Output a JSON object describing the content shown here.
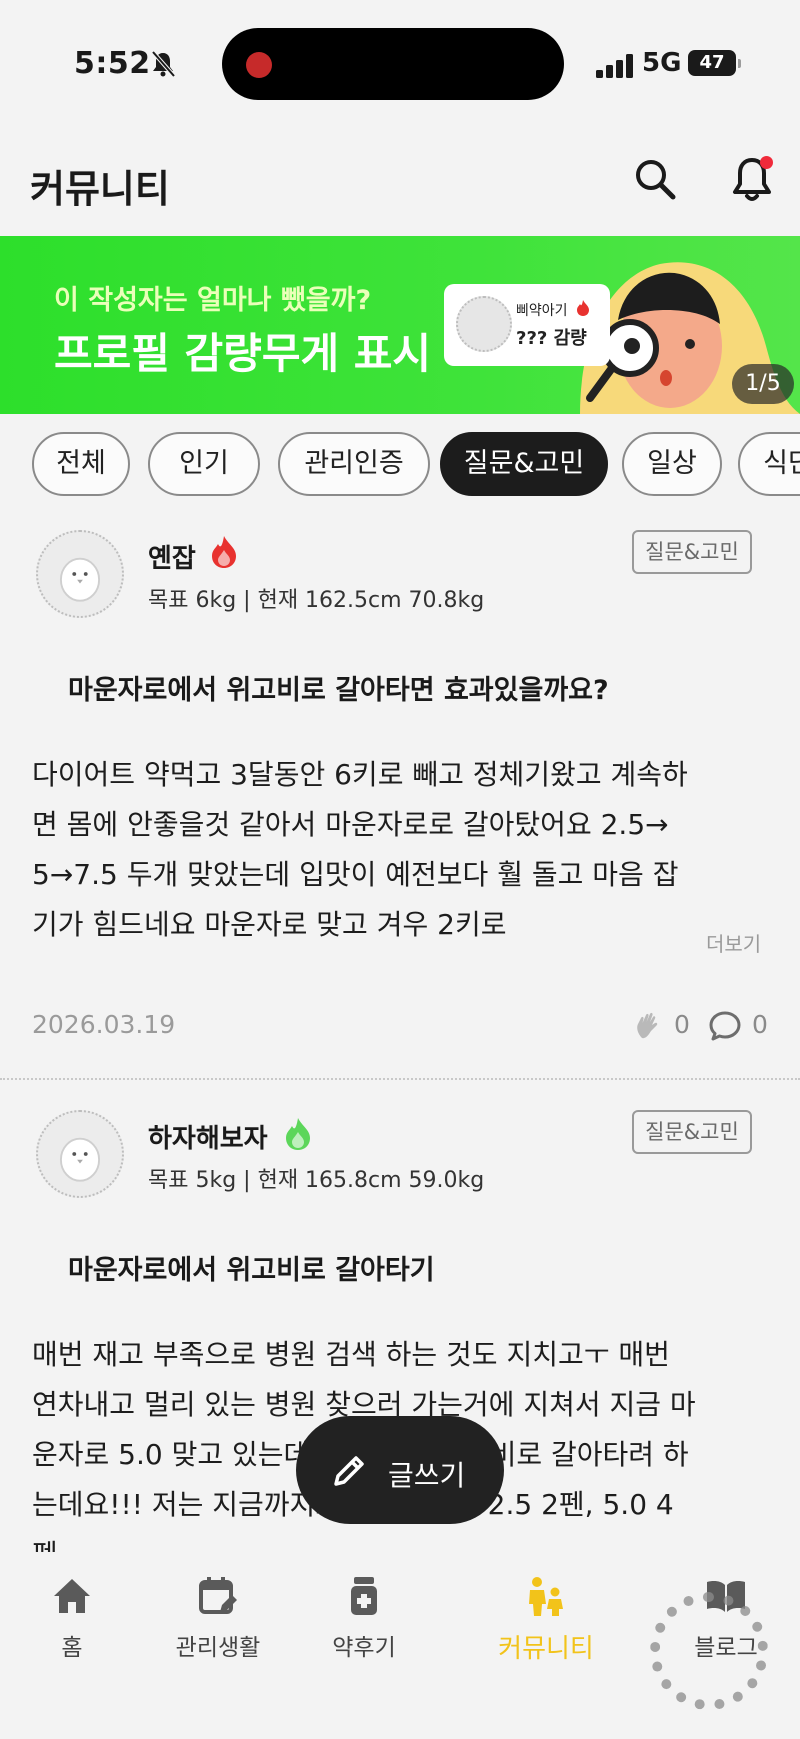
{
  "status_bar": {
    "time": "5:52",
    "network": "5G",
    "battery": "47"
  },
  "header": {
    "title": "커뮤니티"
  },
  "banner": {
    "subtitle": "이 작성자는 얼마나 뺐을까?",
    "title": "프로필 감량무게 표시",
    "card_name": "삐약아기",
    "card_weight": "??? 감량",
    "counter": "1/5"
  },
  "chips": [
    "전체",
    "인기",
    "관리인증",
    "질문&고민",
    "일상",
    "식단"
  ],
  "active_chip": "질문&고민",
  "posts": [
    {
      "nickname": "옌잡",
      "flame_color": "#e8322f",
      "stats": "목표 6kg | 현재 162.5cm  70.8kg",
      "tag": "질문&고민",
      "title": "마운자로에서 위고비로 갈아타면 효과있을까요?",
      "body": "다이어트 약먹고 3달동안 6키로 빼고 정체기왔고 계속하면 몸에 안좋을것 같아서 마운자로로 갈아탔어요 2.5→ 5→7.5 두개 맞았는데 입맛이 예전보다 훨 돌고 마음 잡기가 힘드네요 마운자로 맞고 겨우 2키로",
      "more": "더보기",
      "date": "2026.03.19",
      "likes": "0",
      "comments": "0"
    },
    {
      "nickname": "하자해보자",
      "flame_color": "#5cd65a",
      "stats": "목표 5kg | 현재 165.8cm  59.0kg",
      "tag": "질문&고민",
      "title": "마운자로에서 위고비로 갈아타기",
      "body": "매번 재고 부족으로 병원 검색 하는 것도 지치고ㅜ 매번 연차내고 멀리 있는 병원 찾으러 가는거에 지쳐서 지금 마운자로 5.0 맞고 있는데 다음 맞고 위고비로 갈아타려 하는데요!!! 저는 지금까지로는 마운자로 2.5 2펜, 5.0 4펜"
    }
  ],
  "fab": {
    "label": "글쓰기"
  },
  "bottom_nav": [
    {
      "label": "홈",
      "icon": "home-icon"
    },
    {
      "label": "관리생활",
      "icon": "calendar-edit-icon"
    },
    {
      "label": "약후기",
      "icon": "pill-bottle-icon"
    },
    {
      "label": "커뮤니티",
      "icon": "community-icon"
    },
    {
      "label": "블로그",
      "icon": "book-icon"
    }
  ],
  "active_nav": "커뮤니티"
}
